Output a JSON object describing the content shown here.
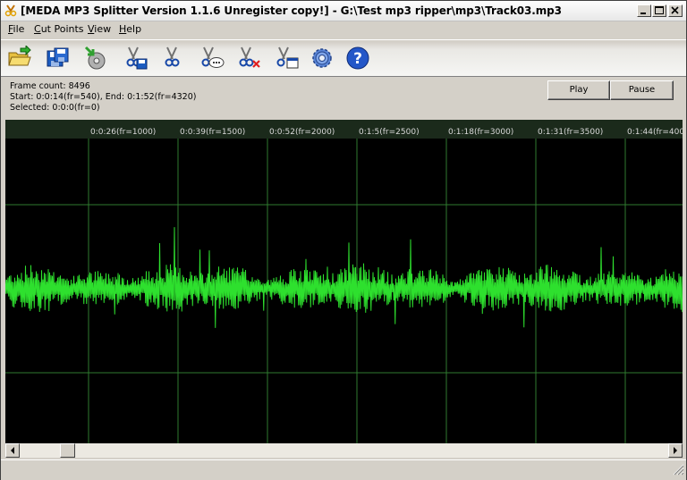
{
  "window": {
    "title": "[MEDA MP3 Splitter Version 1.1.6 Unregister copy!] - G:\\Test mp3 ripper\\mp3\\Track03.mp3",
    "icon": "scissors-app-icon"
  },
  "menu": [
    {
      "first": "F",
      "rest": "ile"
    },
    {
      "first": "C",
      "rest": "ut Points"
    },
    {
      "first": "V",
      "rest": "iew"
    },
    {
      "first": "H",
      "rest": "elp"
    }
  ],
  "toolbar": {
    "tools": [
      "open-folder-icon",
      "save-icon",
      "import-icon",
      "cut-save-icon",
      "cut-icon",
      "cut-comment-icon",
      "cut-delete-icon",
      "cut-window-icon",
      "settings-gear-icon",
      "help-icon"
    ]
  },
  "info": {
    "frame_count": "Frame count: 8496",
    "start_end": "Start: 0:0:14(fr=540), End: 0:1:52(fr=4320)",
    "selected": "Selected: 0:0:0(fr=0)"
  },
  "buttons": {
    "play": "Play",
    "pause": "Pause"
  },
  "timeline": {
    "labels": [
      "0:0:26(fr=1000)",
      "0:0:39(fr=1500)",
      "0:0:52(fr=2000)",
      "0:1:5(fr=2500)",
      "0:1:18(fr=3000)",
      "0:1:31(fr=3500)",
      "0:1:44(fr=400"
    ]
  },
  "colors": {
    "waveform": "#2ee02e",
    "grid": "#2f7a2f",
    "background": "#000000"
  }
}
